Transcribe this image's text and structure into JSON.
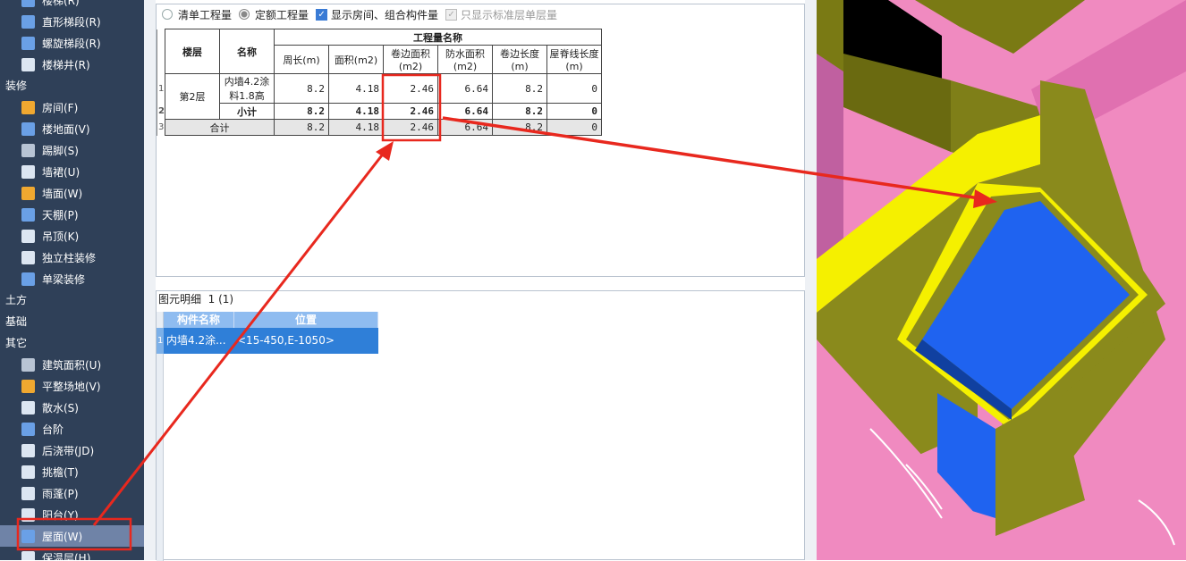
{
  "sidebar": {
    "items_top": [
      {
        "label": "楼梯(R)",
        "icon": "stair-icon"
      },
      {
        "label": "直形梯段(R)",
        "icon": "straight-flight-icon"
      },
      {
        "label": "螺旋梯段(R)",
        "icon": "spiral-flight-icon"
      },
      {
        "label": "楼梯井(R)",
        "icon": "stair-well-icon"
      }
    ],
    "group_decoration": "装修",
    "items_decoration": [
      {
        "label": "房间(F)",
        "icon": "room-icon"
      },
      {
        "label": "楼地面(V)",
        "icon": "floor-icon"
      },
      {
        "label": "踢脚(S)",
        "icon": "skirting-icon"
      },
      {
        "label": "墙裙(U)",
        "icon": "wainscot-icon"
      },
      {
        "label": "墙面(W)",
        "icon": "wall-face-icon"
      },
      {
        "label": "天棚(P)",
        "icon": "ceiling-icon"
      },
      {
        "label": "吊顶(K)",
        "icon": "suspended-ceiling-icon"
      },
      {
        "label": "独立柱装修",
        "icon": "column-finish-icon"
      },
      {
        "label": "单梁装修",
        "icon": "beam-finish-icon"
      }
    ],
    "group_earth": "土方",
    "group_foundation": "基础",
    "group_other": "其它",
    "items_other": [
      {
        "label": "建筑面积(U)",
        "icon": "building-area-icon"
      },
      {
        "label": "平整场地(V)",
        "icon": "site-leveling-icon"
      },
      {
        "label": "散水(S)",
        "icon": "apron-icon"
      },
      {
        "label": "台阶",
        "icon": "steps-icon"
      },
      {
        "label": "后浇带(JD)",
        "icon": "post-pour-strip-icon"
      },
      {
        "label": "挑檐(T)",
        "icon": "eave-icon"
      },
      {
        "label": "雨蓬(P)",
        "icon": "canopy-icon"
      },
      {
        "label": "阳台(Y)",
        "icon": "balcony-icon"
      },
      {
        "label": "屋面(W)",
        "icon": "roof-icon"
      },
      {
        "label": "保温层(H)",
        "icon": "insulation-icon"
      }
    ]
  },
  "options": {
    "bill_qty": "清单工程量",
    "quota_qty": "定额工程量",
    "show_room": "显示房间、组合构件量",
    "std_only": "只显示标准层单层量"
  },
  "table": {
    "head_floor": "楼层",
    "head_name": "名称",
    "head_group": "工程量名称",
    "columns": [
      "周长(m)",
      "面积(m2)",
      "卷边面积(m2)",
      "防水面积(m2)",
      "卷边长度(m)",
      "屋脊线长度(m)"
    ],
    "row_numbers": [
      "1",
      "2",
      "3"
    ],
    "floor": "第2层",
    "name": "内墙4.2涂料1.8高",
    "row1": [
      "8.2",
      "4.18",
      "2.46",
      "6.64",
      "8.2",
      "0"
    ],
    "subtotal_label": "小计",
    "row2": [
      "8.2",
      "4.18",
      "2.46",
      "6.64",
      "8.2",
      "0"
    ],
    "total_label": "合计",
    "row3": [
      "8.2",
      "4.18",
      "2.46",
      "6.64",
      "8.2",
      "0"
    ]
  },
  "detail": {
    "title": "图元明细",
    "count": "1 (1)",
    "col_name": "构件名称",
    "col_pos": "位置",
    "row_no": "1",
    "name": "内墙4.2涂...",
    "pos": "<15-450,E-1050>"
  },
  "colors": {
    "sidebar_bg": "#2f4058",
    "sidebar_active": "#6f83a7",
    "selection_blue": "#2f7fd8",
    "annotation_red": "#e8281e",
    "wall_olive": "#8a8a1c",
    "edge_yellow": "#f5f000",
    "floor_pink": "#f08ac0",
    "slab_blue": "#1f63f0"
  }
}
